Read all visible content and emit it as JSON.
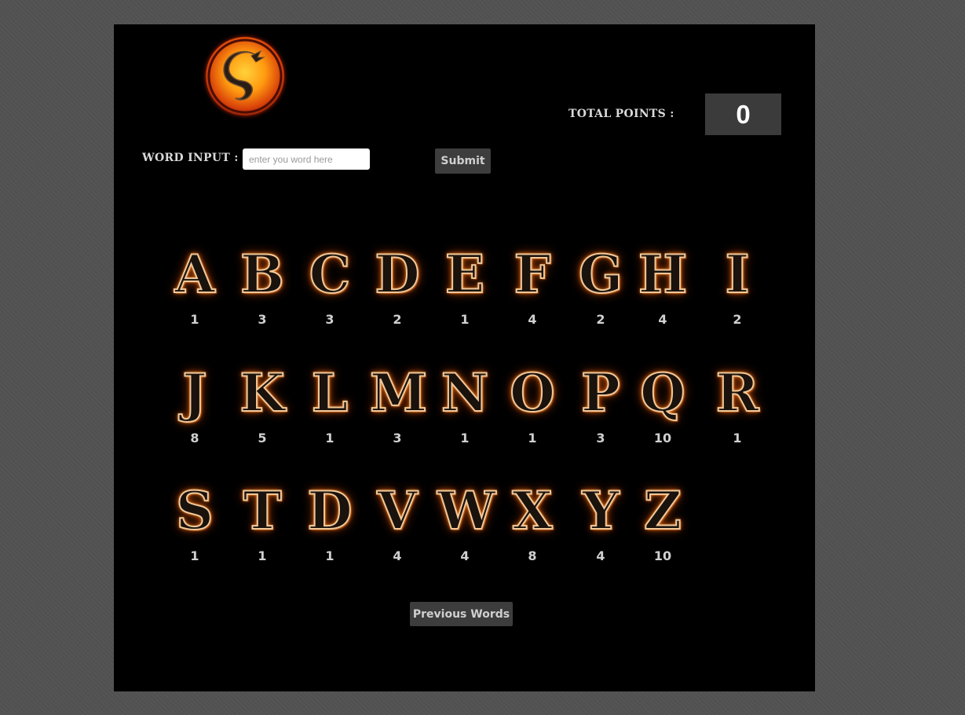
{
  "header": {
    "total_points_label": "TOTAL POINTS :",
    "total_points_value": "0"
  },
  "word_input": {
    "label": "WORD INPUT :",
    "placeholder": "enter you word here",
    "value": ""
  },
  "buttons": {
    "submit_label": "Submit",
    "previous_words_label": "Previous Words"
  },
  "logo": {
    "icon": "dragon-emblem-icon"
  },
  "letters": [
    {
      "letter": "A",
      "points": "1"
    },
    {
      "letter": "B",
      "points": "3"
    },
    {
      "letter": "C",
      "points": "3"
    },
    {
      "letter": "D",
      "points": "2"
    },
    {
      "letter": "E",
      "points": "1"
    },
    {
      "letter": "F",
      "points": "4"
    },
    {
      "letter": "G",
      "points": "2"
    },
    {
      "letter": "H",
      "points": "4"
    },
    {
      "letter": "I",
      "points": "2"
    },
    {
      "letter": "J",
      "points": "8"
    },
    {
      "letter": "K",
      "points": "5"
    },
    {
      "letter": "L",
      "points": "1"
    },
    {
      "letter": "M",
      "points": "3"
    },
    {
      "letter": "N",
      "points": "1"
    },
    {
      "letter": "O",
      "points": "1"
    },
    {
      "letter": "P",
      "points": "3"
    },
    {
      "letter": "Q",
      "points": "10"
    },
    {
      "letter": "R",
      "points": "1"
    },
    {
      "letter": "S",
      "points": "1"
    },
    {
      "letter": "T",
      "points": "1"
    },
    {
      "letter": "D",
      "points": "1"
    },
    {
      "letter": "V",
      "points": "4"
    },
    {
      "letter": "W",
      "points": "4"
    },
    {
      "letter": "X",
      "points": "8"
    },
    {
      "letter": "Y",
      "points": "4"
    },
    {
      "letter": "Z",
      "points": "10"
    }
  ],
  "colors": {
    "background": "#555555",
    "panel": "#000000",
    "score_box": "#3b3b3b",
    "button": "#3d3d3d",
    "fire_accent": "#e06010"
  }
}
